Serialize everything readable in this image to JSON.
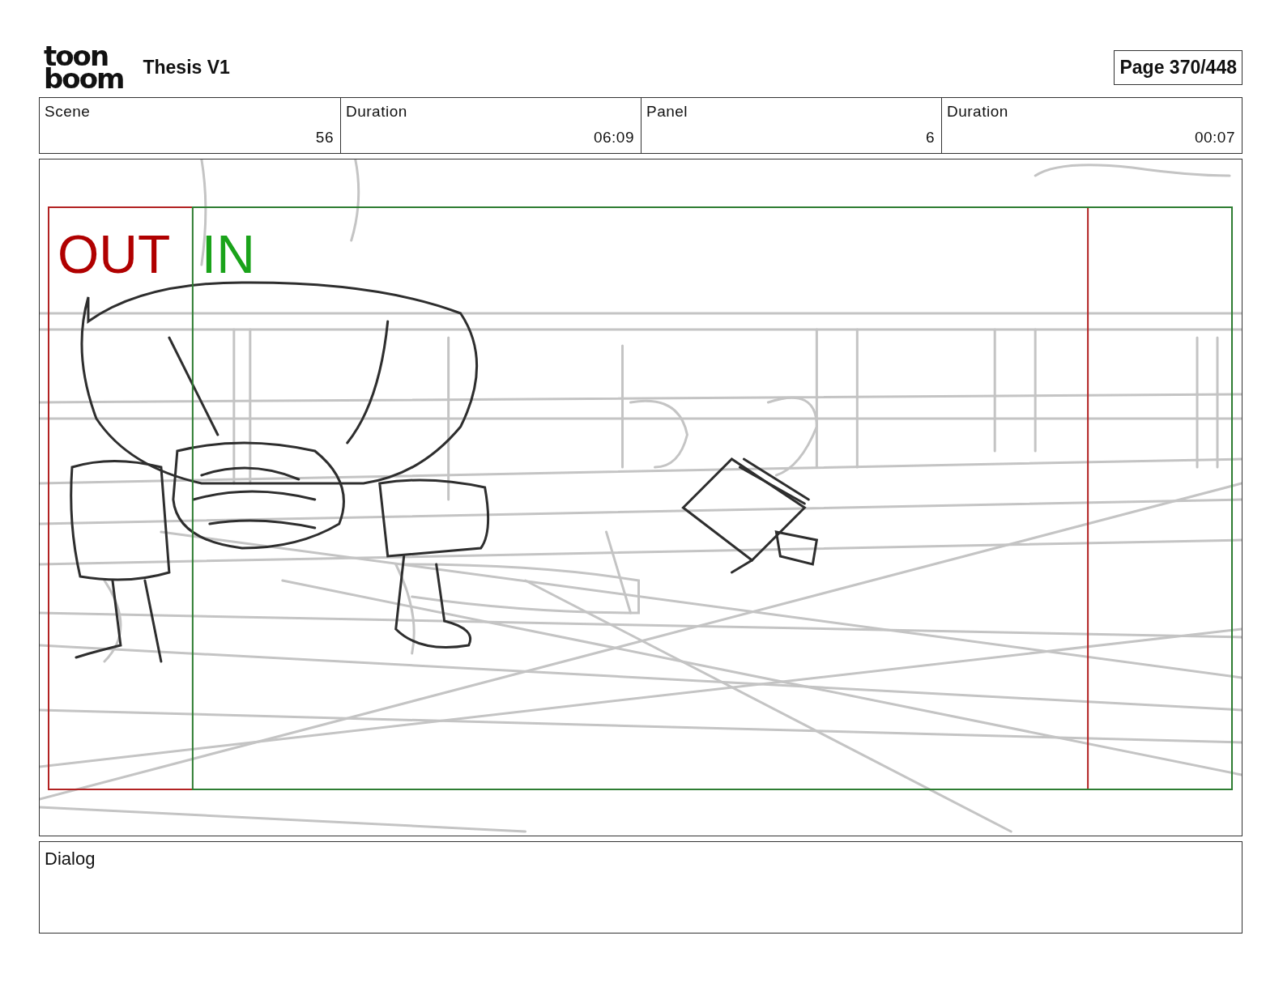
{
  "header": {
    "logo_lines": [
      "toon",
      "boom"
    ],
    "title": "Thesis V1",
    "page": "Page 370/448"
  },
  "info_cells": [
    {
      "heading": "Scene",
      "entry": "56"
    },
    {
      "heading": "Duration",
      "entry": "06:09"
    },
    {
      "heading": "Panel",
      "entry": "6"
    },
    {
      "heading": "Duration",
      "entry": "00:07"
    }
  ],
  "panel": {
    "out_label": "OUT",
    "in_label": "IN"
  },
  "dialog": {
    "label": "Dialog"
  }
}
